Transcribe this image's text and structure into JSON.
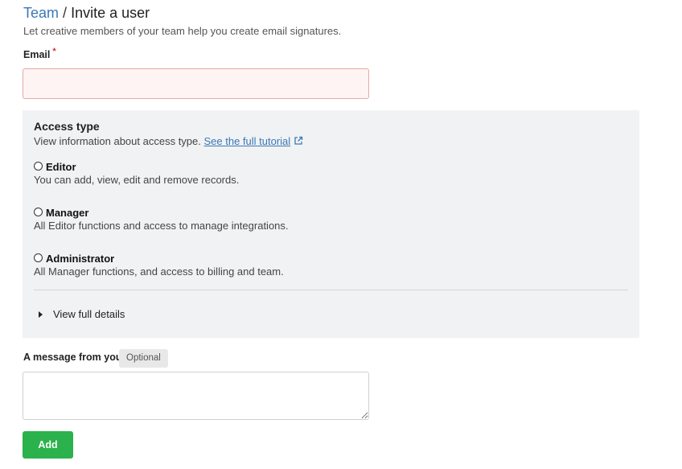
{
  "header": {
    "breadcrumb_link": "Team",
    "separator": "/",
    "current": "Invite a user",
    "subtitle": "Let creative members of your team help you create email signatures."
  },
  "email": {
    "label": "Email",
    "required_mark": "*",
    "value": "",
    "placeholder": ""
  },
  "access": {
    "title": "Access type",
    "description": "View information about access type.",
    "tutorial_link": "See the full tutorial",
    "tutorial_link_icon": "external-link-icon",
    "options": [
      {
        "label": "Editor",
        "description": "You can add, view, edit and remove records.",
        "selected": false
      },
      {
        "label": "Manager",
        "description": "All Editor functions and access to manage integrations.",
        "selected": false
      },
      {
        "label": "Administrator",
        "description": "All Manager functions, and access to billing and team.",
        "selected": false
      }
    ],
    "details_toggle": "View full details",
    "details_icon": "caret-right-icon"
  },
  "message": {
    "label": "A message from you",
    "optional_badge": "Optional",
    "value": ""
  },
  "actions": {
    "add_label": "Add"
  },
  "colors": {
    "link": "#3b78b6",
    "required": "#d0343a",
    "panel_bg": "#f1f2f4",
    "email_bg": "#fff4f4",
    "email_border": "#e6a8a8",
    "primary_button": "#2bb24c"
  }
}
